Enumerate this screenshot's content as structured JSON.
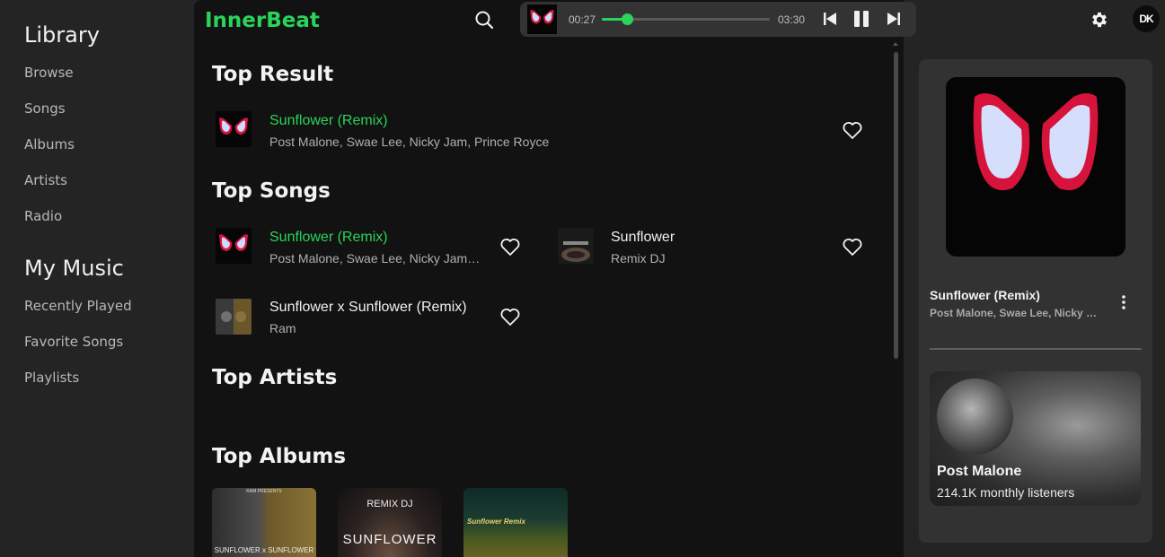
{
  "app": {
    "name": "InnerBeat"
  },
  "sidebar": {
    "library_title": "Library",
    "library_items": [
      "Browse",
      "Songs",
      "Albums",
      "Artists",
      "Radio"
    ],
    "mymusic_title": "My Music",
    "mymusic_items": [
      "Recently Played",
      "Favorite Songs",
      "Playlists"
    ]
  },
  "player": {
    "current_time": "00:27",
    "total_time": "03:30",
    "progress": 0.15,
    "state": "playing"
  },
  "user": {
    "initials": "DK"
  },
  "main": {
    "top_result": {
      "heading": "Top Result",
      "title": "Sunflower (Remix)",
      "artist": "Post Malone, Swae Lee, Nicky Jam, Prince Royce"
    },
    "top_songs": {
      "heading": "Top Songs",
      "items": [
        {
          "title": "Sunflower (Remix)",
          "artist": "Post Malone, Swae Lee, Nicky Jam, Prince Royce",
          "active": true
        },
        {
          "title": "Sunflower",
          "artist": "Remix DJ",
          "active": false
        },
        {
          "title": "Sunflower x Sunflower (Remix)",
          "artist": "Ram",
          "active": false
        }
      ]
    },
    "top_artists": {
      "heading": "Top Artists"
    },
    "top_albums": {
      "heading": "Top Albums",
      "albums": [
        {
          "caption_top": "RAM PRESENTS",
          "caption_bottom": "SUNFLOWER x SUNFLOWER"
        },
        {
          "caption_top": "REMIX DJ",
          "caption_bottom": "SUNFLOWER"
        },
        {
          "caption_top": "Sunflower Remix",
          "caption_bottom": ""
        }
      ]
    }
  },
  "now_playing": {
    "title": "Sunflower (Remix)",
    "artist": "Post Malone, Swae Lee, Nicky Jam, Prince Royce"
  },
  "artist_card": {
    "name": "Post Malone",
    "listeners": "214.1K monthly listeners"
  },
  "colors": {
    "accent": "#2bd35a",
    "background": "#121212",
    "panel": "#323232"
  }
}
